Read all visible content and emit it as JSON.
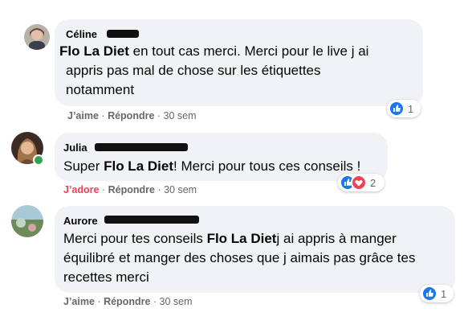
{
  "comments": [
    {
      "author": "Céline",
      "tag": "Flo La Diet",
      "text_lines": [
        " en tout cas merci. Merci pour le live j ai",
        "appris pas mal de chose sur les étiquettes",
        "notamment"
      ],
      "like_label": "J’aime",
      "reply_label": "Répondre",
      "time": "30 sem",
      "reaction_count": "1",
      "reactions": [
        "like-icon"
      ]
    },
    {
      "author": "Julia",
      "text_before": "Super ",
      "tag": "Flo La Diet",
      "text_after": "! Merci pour tous ces conseils !",
      "like_label": "J’adore",
      "reply_label": "Répondre",
      "time": "30 sem",
      "reaction_count": "2",
      "reactions": [
        "like-icon",
        "love-icon"
      ]
    },
    {
      "author": "Aurore",
      "text_before": "Merci pour tes conseils ",
      "tag": "Flo La Diet",
      "text_after_lines": [
        "j ai appris à manger",
        "équilibré et manger des choses que j aimais pas grâce tes",
        "recettes merci"
      ],
      "like_label": "J’aime",
      "reply_label": "Répondre",
      "time": "30 sem",
      "reaction_count": "1",
      "reactions": [
        "like-icon"
      ]
    }
  ],
  "separator": "·",
  "colors": {
    "bubble": "#f0f2f5",
    "like": "#1877f2",
    "love": "#f33e58",
    "meta": "#65676b"
  }
}
